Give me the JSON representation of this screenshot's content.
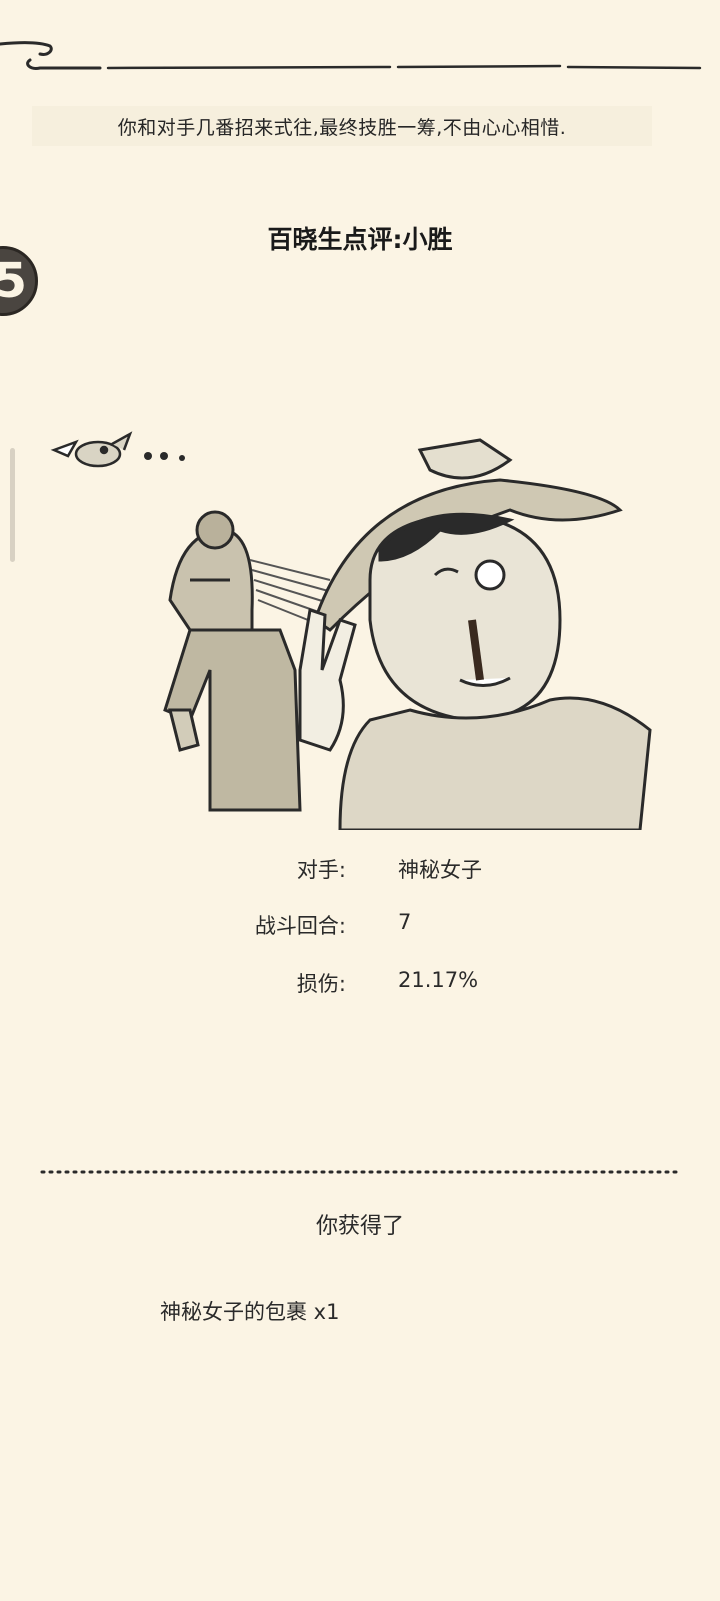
{
  "story": {
    "intro_text": "你和对手几番招来式往,最终技胜一筹,不由心心相惜."
  },
  "verdict": {
    "text": "百晓生点评:小胜"
  },
  "round_badge": {
    "glyph": "5"
  },
  "battle_stats": {
    "rows": [
      {
        "label": "对手:",
        "value": "神秘女子"
      },
      {
        "label": "战斗回合:",
        "value": "7"
      },
      {
        "label": "损伤:",
        "value": "21.17%"
      }
    ]
  },
  "rewards": {
    "title": "你获得了",
    "items": [
      {
        "text": "神秘女子的包裹 x1"
      }
    ]
  },
  "colors": {
    "background": "#fbf4e4",
    "ink": "#1e1e1e",
    "badge": "#4a4540"
  }
}
